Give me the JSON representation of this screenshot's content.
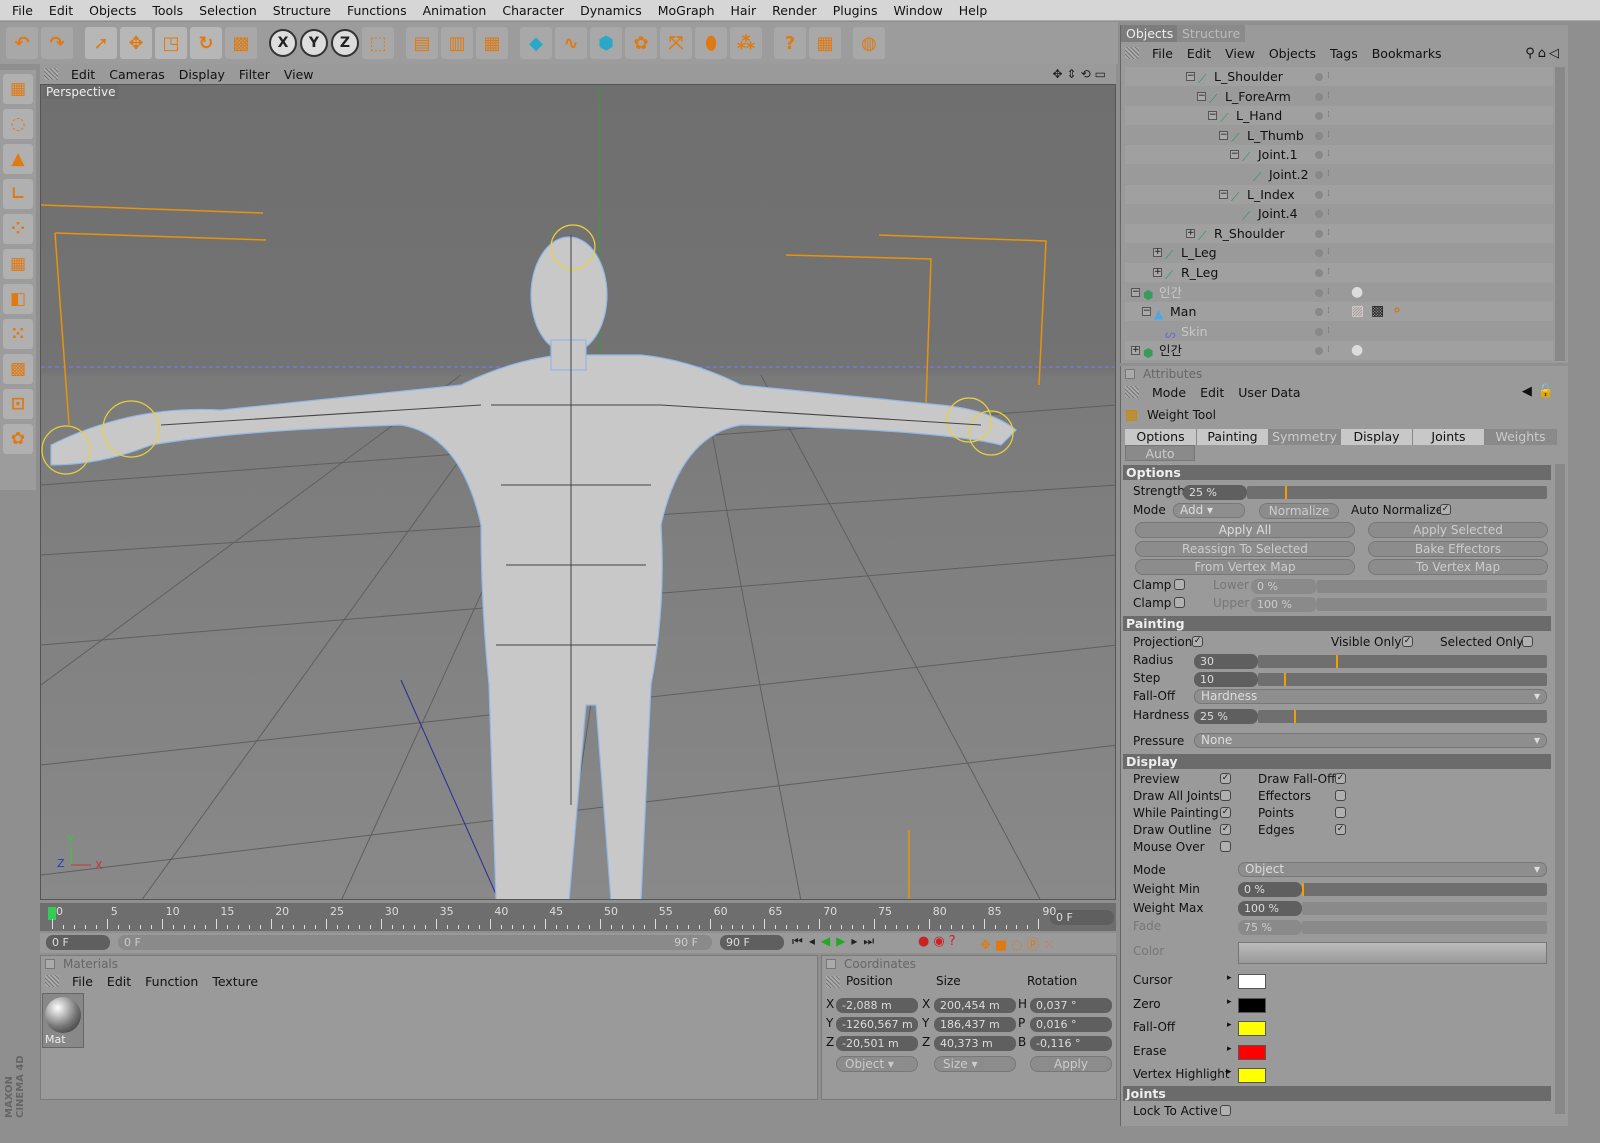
{
  "menu": [
    "File",
    "Edit",
    "Objects",
    "Tools",
    "Selection",
    "Structure",
    "Functions",
    "Animation",
    "Character",
    "Dynamics",
    "MoGraph",
    "Hair",
    "Render",
    "Plugins",
    "Window",
    "Help"
  ],
  "toolbar": {
    "icons": [
      "undo-icon",
      "redo-icon",
      "select-icon",
      "move-icon",
      "scale-icon",
      "rotate-icon",
      "weight-tool-icon",
      "x-axis-lock-icon",
      "y-axis-lock-icon",
      "z-axis-lock-icon",
      "coordinate-system-icon",
      "render-view-icon",
      "render-picture-viewer-icon",
      "render-settings-icon",
      "cube-icon",
      "spline-icon",
      "nurbs-icon",
      "array-icon",
      "deformer-icon",
      "scene-icon",
      "light-icon",
      "help-icon",
      "timeline-icon",
      "browser-icon"
    ],
    "axis_labels": [
      "X",
      "Y",
      "Z"
    ]
  },
  "viewport": {
    "menu": [
      "Edit",
      "Cameras",
      "Display",
      "Filter",
      "View"
    ],
    "label": "Perspective",
    "axes": {
      "x": "X",
      "y": "Y",
      "z": "Z"
    }
  },
  "timeline": {
    "ticks": [
      "0",
      "5",
      "10",
      "15",
      "20",
      "25",
      "30",
      "35",
      "40",
      "45",
      "50",
      "55",
      "60",
      "65",
      "70",
      "75",
      "80",
      "85",
      "90"
    ],
    "current_frame": "0 F",
    "start": "0 F",
    "range_start": "0 F",
    "range_end": "90 F",
    "end": "90 F",
    "position": 0
  },
  "materials": {
    "title": "Materials",
    "menu": [
      "File",
      "Edit",
      "Function",
      "Texture"
    ],
    "items": [
      {
        "name": "Mat"
      }
    ]
  },
  "coordinates": {
    "title": "Coordinates",
    "headers": [
      "Position",
      "Size",
      "Rotation"
    ],
    "rows": [
      {
        "axis": "X",
        "position": "-2,088 m",
        "size_axis": "X",
        "size": "200,454 m",
        "rot_axis": "H",
        "rotation": "0,037 °"
      },
      {
        "axis": "Y",
        "position": "-1260,567 m",
        "size_axis": "Y",
        "size": "186,437 m",
        "rot_axis": "P",
        "rotation": "0,016 °"
      },
      {
        "axis": "Z",
        "position": "-20,501 m",
        "size_axis": "Z",
        "size": "40,373 m",
        "rot_axis": "B",
        "rotation": "-0,116 °"
      }
    ],
    "mode_dropdown": "Object",
    "size_dropdown": "Size",
    "apply": "Apply"
  },
  "objects": {
    "tabs": [
      "Objects",
      "Structure"
    ],
    "menu": [
      "File",
      "Edit",
      "View",
      "Objects",
      "Tags",
      "Bookmarks"
    ],
    "tree": [
      {
        "name": "L_Shoulder",
        "depth": 5,
        "exp": "-"
      },
      {
        "name": "L_ForeArm",
        "depth": 6,
        "exp": "-"
      },
      {
        "name": "L_Hand",
        "depth": 7,
        "exp": "-"
      },
      {
        "name": "L_Thumb",
        "depth": 8,
        "exp": "-"
      },
      {
        "name": "Joint.1",
        "depth": 9,
        "exp": "-"
      },
      {
        "name": "Joint.2",
        "depth": 10,
        "exp": ""
      },
      {
        "name": "L_Index",
        "depth": 8,
        "exp": "-"
      },
      {
        "name": "Joint.4",
        "depth": 9,
        "exp": ""
      },
      {
        "name": "R_Shoulder",
        "depth": 5,
        "exp": "+"
      },
      {
        "name": "L_Leg",
        "depth": 2,
        "exp": "+"
      },
      {
        "name": "R_Leg",
        "depth": 2,
        "exp": "+"
      },
      {
        "name": "인간",
        "depth": 0,
        "exp": "-",
        "dim": true,
        "icon": "null-object",
        "tags": [
          "material-tag"
        ]
      },
      {
        "name": "Man",
        "depth": 1,
        "exp": "-",
        "dim": false,
        "icon": "polygon",
        "tags": [
          "weight-tag",
          "texture-tag",
          "joint-tag"
        ]
      },
      {
        "name": "Skin",
        "depth": 2,
        "exp": "",
        "dim": true,
        "icon": "skin"
      },
      {
        "name": "인간",
        "depth": 0,
        "exp": "+",
        "icon": "null-object",
        "tags": [
          "material-tag"
        ]
      }
    ]
  },
  "attributes": {
    "title": "Attributes",
    "menu": [
      "Mode",
      "Edit",
      "User Data"
    ],
    "tool": "Weight Tool",
    "tabs": [
      {
        "label": "Options",
        "active": true
      },
      {
        "label": "Painting",
        "active": true
      },
      {
        "label": "Symmetry",
        "active": false
      },
      {
        "label": "Display",
        "active": true
      },
      {
        "label": "Joints",
        "active": true
      },
      {
        "label": "Weights",
        "active": false
      },
      {
        "label": "Auto Weight",
        "active": false
      }
    ],
    "options": {
      "title": "Options",
      "strength_label": "Strength",
      "strength": "25 %",
      "strength_value": 0.25,
      "mode_label": "Mode",
      "mode": "Add",
      "normalize": "Normalize",
      "auto_normalize": "Auto Normalize",
      "auto_normalize_checked": true,
      "buttons": [
        "Apply All",
        "Apply Selected",
        "Reassign To Selected",
        "Bake Effectors",
        "From Vertex Map",
        "To Vertex Map"
      ],
      "clamp_label": "Clamp",
      "lower_label": "Lower",
      "lower": "0 %",
      "upper_label": "Upper",
      "upper": "100 %"
    },
    "painting": {
      "title": "Painting",
      "projection": "Projection",
      "visible_only": "Visible Only",
      "selected_only": "Selected Only",
      "radius_label": "Radius",
      "radius": "30",
      "radius_value": 30,
      "step_label": "Step",
      "step": "10",
      "step_value": 10,
      "falloff_label": "Fall-Off",
      "falloff": "Hardness",
      "hardness_label": "Hardness",
      "hardness": "25 %",
      "hardness_value": 0.25,
      "pressure_label": "Pressure",
      "pressure": "None"
    },
    "display": {
      "title": "Display",
      "left": [
        {
          "label": "Preview",
          "checked": true
        },
        {
          "label": "Draw All Joints",
          "checked": false
        },
        {
          "label": "While Painting",
          "checked": true
        },
        {
          "label": "Draw Outline",
          "checked": true
        },
        {
          "label": "Mouse Over",
          "checked": false
        }
      ],
      "right": [
        {
          "label": "Draw Fall-Off",
          "checked": true
        },
        {
          "label": "Effectors",
          "checked": false
        },
        {
          "label": "Points",
          "checked": false
        },
        {
          "label": "Edges",
          "checked": true
        }
      ],
      "mode_label": "Mode",
      "mode": "Object",
      "wmin_label": "Weight Min",
      "wmin": "0 %",
      "wmax_label": "Weight Max",
      "wmax": "100 %",
      "fade_label": "Fade",
      "fade": "75 %",
      "color_label": "Color",
      "swatches": [
        {
          "label": "Cursor",
          "color": "#ffffff"
        },
        {
          "label": "Zero",
          "color": "#000000"
        },
        {
          "label": "Fall-Off",
          "color": "#ffff00"
        },
        {
          "label": "Erase",
          "color": "#ff0000"
        },
        {
          "label": "Vertex Highlight",
          "color": "#ffff00"
        }
      ]
    },
    "joints": {
      "title": "Joints",
      "lock_to_active": "Lock To Active"
    }
  },
  "logo": "MAXON CINEMA 4D"
}
